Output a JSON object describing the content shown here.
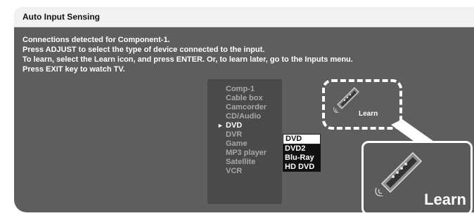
{
  "dialog": {
    "title": "Auto Input Sensing",
    "message_lines": [
      "Connections detected for Component-1.",
      "Press ADJUST to select the type of device connected to the input.",
      "To learn, select the Learn icon, and press ENTER.  Or, to learn later, go to the Inputs menu.",
      "Press EXIT key to watch TV."
    ]
  },
  "device_list": {
    "items": [
      {
        "label": "Comp-1"
      },
      {
        "label": "Cable box"
      },
      {
        "label": "Camcorder"
      },
      {
        "label": "CD/Audio"
      },
      {
        "label": "DVD"
      },
      {
        "label": "DVR"
      },
      {
        "label": "Game"
      },
      {
        "label": "MP3 player"
      },
      {
        "label": "Satellite"
      },
      {
        "label": "VCR"
      }
    ],
    "selected_index": 4,
    "selection_marker": "►"
  },
  "sub_list": {
    "items": [
      {
        "label": "DVD"
      },
      {
        "label": "DVD2"
      },
      {
        "label": "Blu-Ray"
      },
      {
        "label": "HD DVD"
      }
    ],
    "selected_index": 0
  },
  "learn_icon": {
    "small_label": "Learn",
    "large_label": "Learn",
    "icon": "remote-control-icon"
  },
  "colors": {
    "screen_bg": "#5e5e5e",
    "title_bg": "#f1f1f1",
    "list_bg": "#4a4a4a",
    "selected_text": "#ffffff",
    "dim_text": "#a8a8a8"
  }
}
